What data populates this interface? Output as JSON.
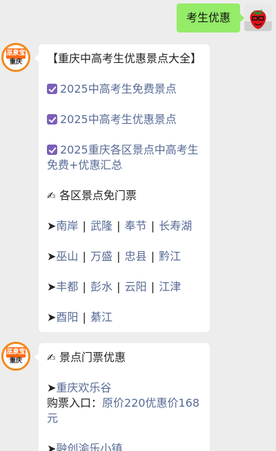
{
  "outgoing": {
    "text": "考生优惠"
  },
  "bot": {
    "logo_text": "巫泉宝",
    "logo_sub": "ksxuchen.com",
    "city": "重庆"
  },
  "card1": {
    "title": "【重庆中高考生优惠景点大全】",
    "checks": [
      "2025中高考生免费景点",
      "2025中高考生优惠景点",
      "2025重庆各区景点中高考生免费+优惠汇总"
    ],
    "section_emoji": "✍",
    "section_title": "各区景点免门票",
    "district_rows": [
      [
        "南岸",
        "武隆",
        "奉节",
        "长寿湖"
      ],
      [
        "巫山",
        "万盛",
        "忠县",
        "黔江"
      ],
      [
        "丰都",
        "彭水",
        "云阳",
        "江津"
      ],
      [
        "酉阳",
        "綦江"
      ]
    ],
    "arrow": "➤",
    "separator": "|"
  },
  "card2": {
    "section_emoji": "✍",
    "section_title": "景点门票优惠",
    "items": [
      {
        "name": "重庆欢乐谷",
        "entry_label": "购票入口：",
        "entry_link": "原价220优惠价168元"
      },
      {
        "name": "融创渝乐小镇"
      }
    ],
    "arrow": "➤"
  }
}
